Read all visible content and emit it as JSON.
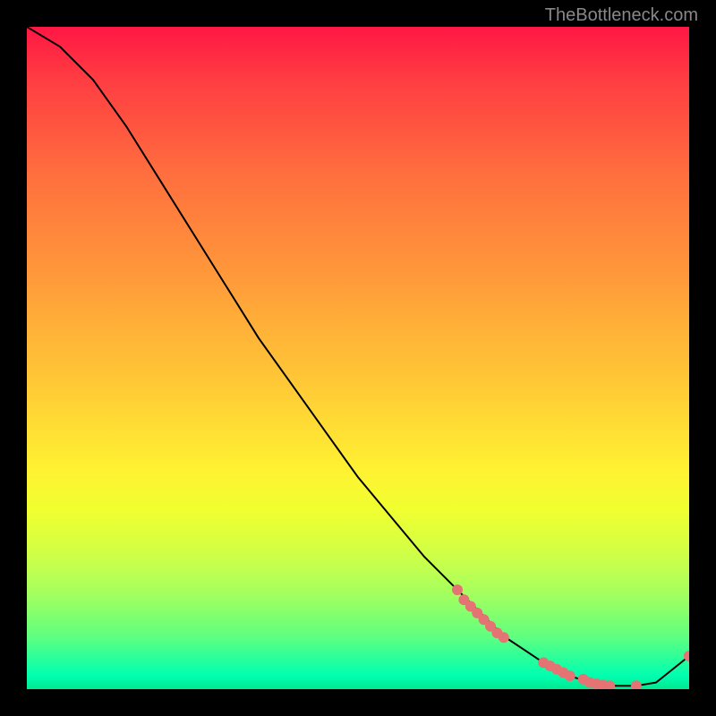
{
  "watermark": "TheBottleneck.com",
  "chart_data": {
    "type": "line",
    "title": "",
    "xlabel": "",
    "ylabel": "",
    "xlim": [
      0,
      100
    ],
    "ylim": [
      0,
      100
    ],
    "series": [
      {
        "name": "curve",
        "x": [
          0,
          5,
          10,
          15,
          20,
          25,
          30,
          35,
          40,
          45,
          50,
          55,
          60,
          65,
          68,
          70,
          72,
          75,
          78,
          80,
          82,
          85,
          88,
          90,
          92,
          95,
          100
        ],
        "y": [
          100,
          97,
          92,
          85,
          77,
          69,
          61,
          53,
          46,
          39,
          32,
          26,
          20,
          15,
          12,
          10,
          8,
          6,
          4,
          3,
          2,
          1,
          0.5,
          0.5,
          0.5,
          1,
          5
        ]
      }
    ],
    "markers": [
      {
        "x": 65,
        "y": 15
      },
      {
        "x": 66,
        "y": 13.5
      },
      {
        "x": 67,
        "y": 12.5
      },
      {
        "x": 68,
        "y": 11.5
      },
      {
        "x": 69,
        "y": 10.5
      },
      {
        "x": 70,
        "y": 9.5
      },
      {
        "x": 71,
        "y": 8.5
      },
      {
        "x": 72,
        "y": 7.8
      },
      {
        "x": 78,
        "y": 4
      },
      {
        "x": 79,
        "y": 3.5
      },
      {
        "x": 80,
        "y": 3
      },
      {
        "x": 81,
        "y": 2.5
      },
      {
        "x": 82,
        "y": 2
      },
      {
        "x": 84,
        "y": 1.5
      },
      {
        "x": 85,
        "y": 1
      },
      {
        "x": 86,
        "y": 0.8
      },
      {
        "x": 87,
        "y": 0.6
      },
      {
        "x": 88,
        "y": 0.5
      },
      {
        "x": 92,
        "y": 0.5
      },
      {
        "x": 100,
        "y": 5
      }
    ],
    "marker_color": "#e57373",
    "line_color": "#000000"
  }
}
